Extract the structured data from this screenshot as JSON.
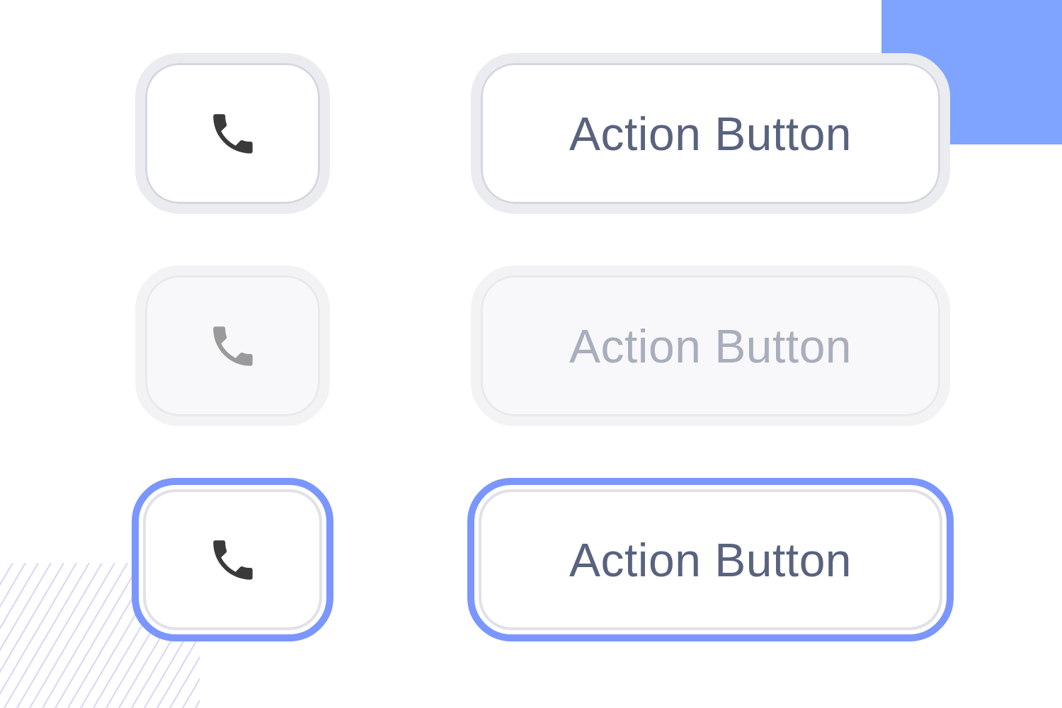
{
  "rows": [
    {
      "disabled": false,
      "focused": false,
      "label": "Action Button"
    },
    {
      "disabled": true,
      "focused": false,
      "label": "Action Button"
    },
    {
      "disabled": false,
      "focused": true,
      "label": "Action Button"
    }
  ]
}
